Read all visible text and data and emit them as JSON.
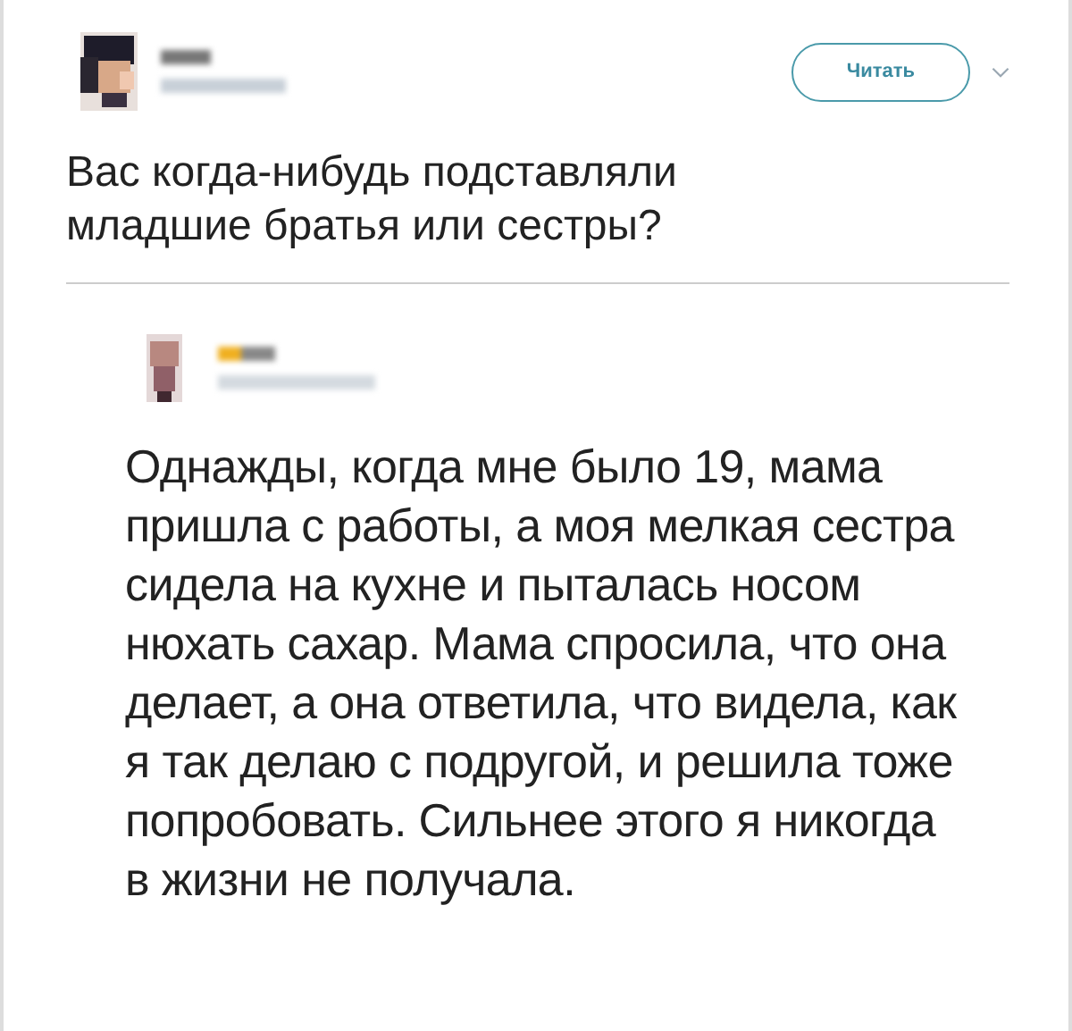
{
  "tweet": {
    "follow_button": "Читать",
    "text": "Вас когда-нибудь подставляли младшие братья или сестры?"
  },
  "reply": {
    "text": "Однажды, когда мне было 19, мама пришла с работы, а моя мелкая сестра сидела на кухне и пыталась носом нюхать сахар. Мама спросила, что она делает, а она ответила, что видела, как я так делаю с подругой, и решила тоже попробовать. Сильнее этого я никогда в жизни не получала."
  }
}
